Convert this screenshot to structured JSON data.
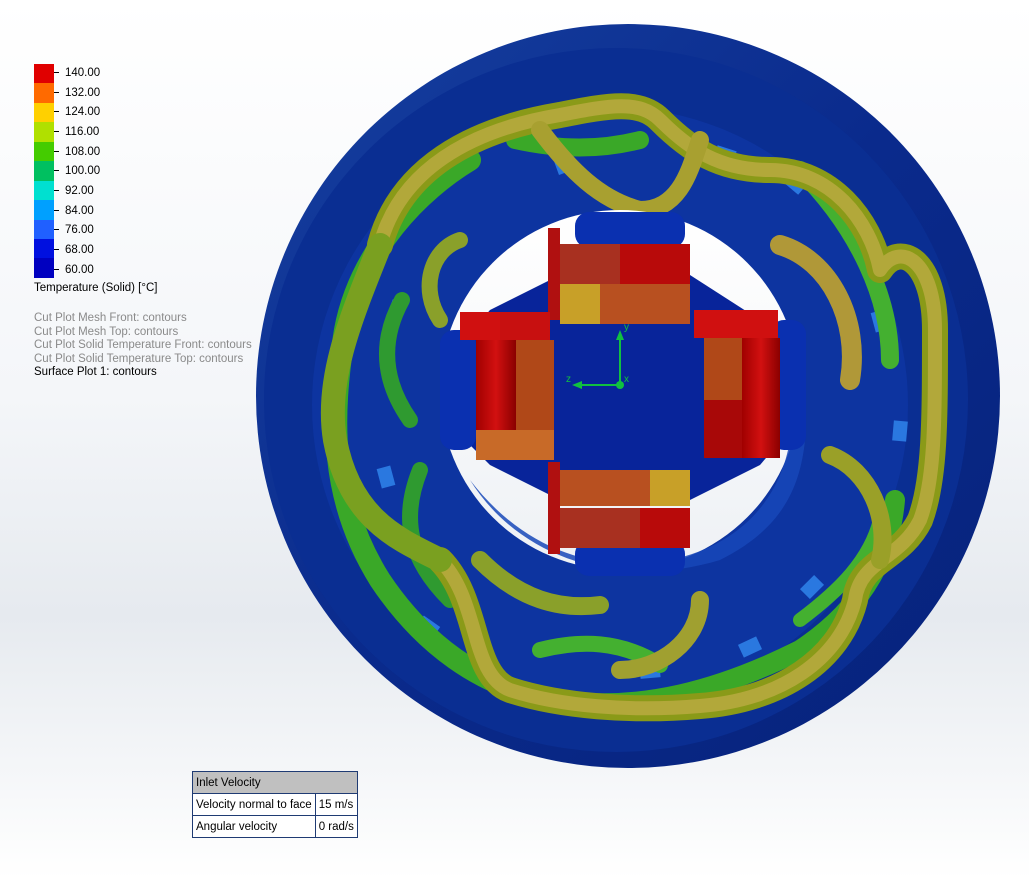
{
  "legend": {
    "ticks": [
      "140.00",
      "132.00",
      "124.00",
      "116.00",
      "108.00",
      "100.00",
      "92.00",
      "84.00",
      "76.00",
      "68.00",
      "60.00"
    ],
    "colors": [
      "#e00000",
      "#ff6a00",
      "#ffd000",
      "#b0e000",
      "#44cc00",
      "#00c060",
      "#00e0d0",
      "#00a0ff",
      "#2060ff",
      "#0010e0",
      "#0000c0"
    ],
    "title": "Temperature (Solid) [°C]"
  },
  "plots": [
    "Cut Plot Mesh Front: contours",
    "Cut Plot Mesh Top: contours",
    "Cut Plot Solid Temperature Front: contours",
    "Cut Plot Solid Temperature Top: contours",
    "Surface Plot 1: contours"
  ],
  "triad": {
    "x_label": "x",
    "y_label": "y",
    "z_label": "z"
  },
  "inlet": {
    "header": "Inlet Velocity",
    "rows": [
      {
        "label": "Velocity normal to face",
        "value": "15 m/s"
      },
      {
        "label": "Angular velocity",
        "value": "0 rad/s"
      }
    ]
  }
}
